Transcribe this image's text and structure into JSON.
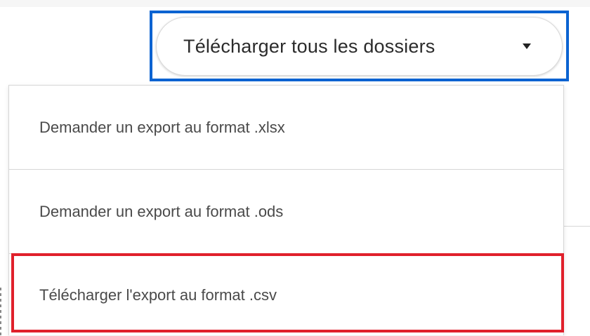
{
  "download_button": {
    "label": "Télécharger tous les dossiers",
    "icon": "caret-down-icon"
  },
  "dropdown": {
    "items": [
      {
        "label": "Demander un export au format .xlsx"
      },
      {
        "label": "Demander un export au format .ods"
      },
      {
        "label": "Télécharger l'export au format .csv"
      }
    ]
  },
  "colors": {
    "highlight_button": "#0b63d1",
    "highlight_item": "#e0202b",
    "menu_text": "#4a4a4a",
    "divider": "#d6d6d6"
  }
}
